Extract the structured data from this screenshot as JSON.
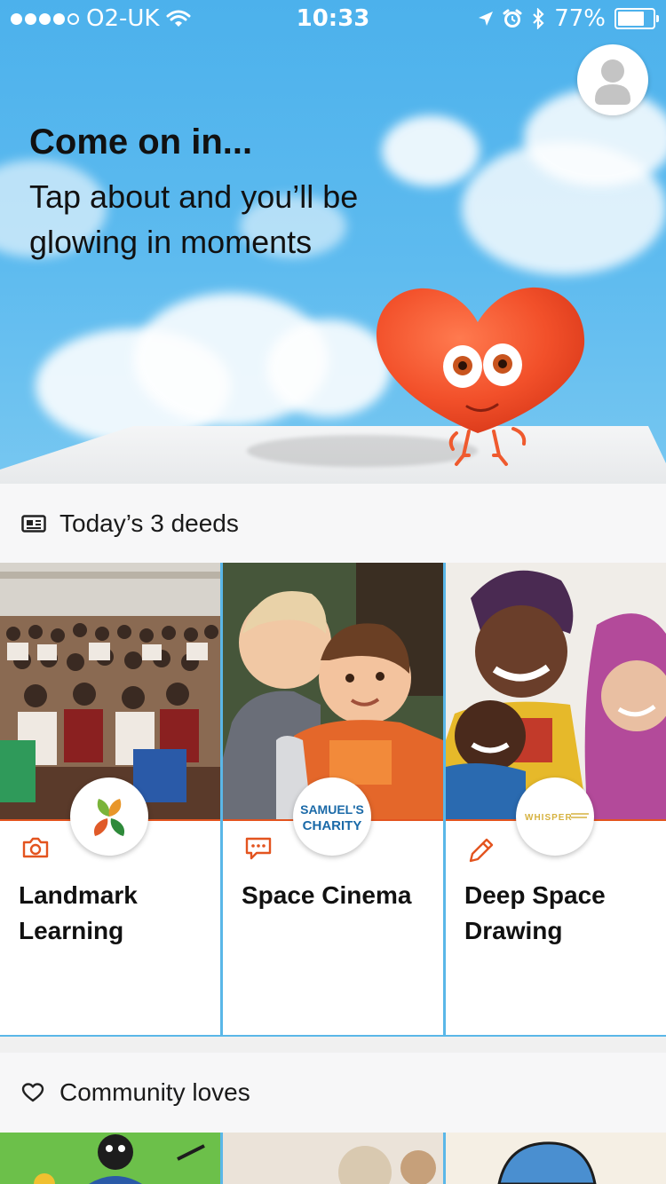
{
  "status_bar": {
    "carrier": "O2-UK",
    "time": "10:33",
    "battery": "77%",
    "battery_level": 0.77
  },
  "hero": {
    "title": "Come on in...",
    "subtitle": "Tap about and you’ll be glowing in moments"
  },
  "deeds": {
    "header": "Today’s 3 deeds",
    "header_icon": "newspaper-icon",
    "cards": [
      {
        "title": "Landmark Learning",
        "type_icon": "camera-icon"
      },
      {
        "title": "Space Cinema",
        "type_icon": "chat-bubble-icon",
        "logo_text": "SAMUEL'S CHARITY"
      },
      {
        "title": "Deep Space Drawing",
        "type_icon": "pencil-icon",
        "logo_text": "WHISPER"
      }
    ]
  },
  "community": {
    "header": "Community loves",
    "header_icon": "heart-outline-icon"
  },
  "colors": {
    "sky": "#5ebbef",
    "accent": "#e3541f",
    "card_divider": "#5ab7e8",
    "heart": "#f2502a"
  }
}
